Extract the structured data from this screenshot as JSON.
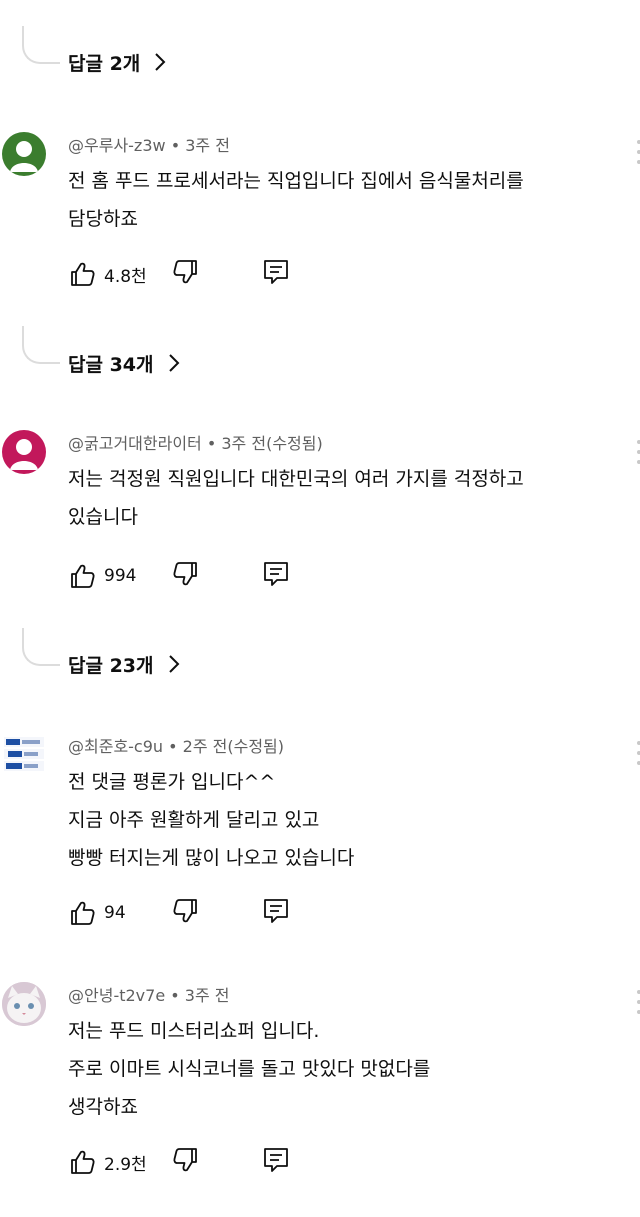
{
  "reply_threads": [
    {
      "label": "답글 2개"
    },
    {
      "label": "답글 34개"
    },
    {
      "label": "답글 23개"
    }
  ],
  "comments": [
    {
      "author": "@우루사-z3w",
      "time": "3주 전",
      "lines": [
        "전 홈 푸드 프로세서라는 직업입니다 집에서 음식물처리를",
        "담당하죠"
      ],
      "likes": "4.8천",
      "avatar_icon": "default-user-avatar",
      "avatar_color": "#3b7d2e"
    },
    {
      "author": "@굵고거대한라이터",
      "time": "3주 전(수정됨)",
      "lines": [
        "저는 걱정원 직원입니다 대한민국의 여러 가지를 걱정하고",
        "있습니다"
      ],
      "likes": "994",
      "avatar_icon": "default-user-avatar",
      "avatar_color": "#c2185b"
    },
    {
      "author": "@최준호-c9u",
      "time": "2주 전(수정됨)",
      "lines": [
        "전 댓글 평론가 입니다^^",
        "지금 아주 원활하게 달리고 있고",
        "빵빵 터지는게 많이 나오고 있습니다"
      ],
      "likes": "94",
      "avatar_icon": "badge-image-avatar",
      "avatar_color": "#1e4fa3"
    },
    {
      "author": "@안녕-t2v7e",
      "time": "3주 전",
      "lines": [
        "저는 푸드 미스터리쇼퍼 입니다.",
        "주로 이마트 시식코너를 돌고 맛있다 맛없다를",
        "생각하죠"
      ],
      "likes": "2.9천",
      "avatar_icon": "cat-photo-avatar",
      "avatar_color": "#d8c8d4"
    }
  ],
  "icons": {
    "like": "thumbs-up-icon",
    "dislike": "thumbs-down-icon",
    "reply": "comment-reply-icon",
    "expand": "chevron-right-icon",
    "menu": "more-vert-icon"
  },
  "colors": {
    "meta_text": "#606060",
    "thread_line": "#dcdcdc"
  }
}
